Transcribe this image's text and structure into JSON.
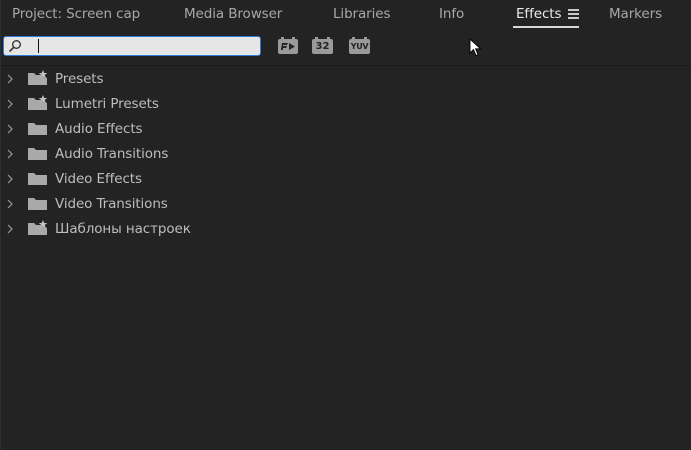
{
  "tabs": [
    {
      "label": "Project: Screen cap",
      "active": false
    },
    {
      "label": "Media Browser",
      "active": false
    },
    {
      "label": "Libraries",
      "active": false
    },
    {
      "label": "Info",
      "active": false
    },
    {
      "label": "Effects",
      "active": true
    },
    {
      "label": "Markers",
      "active": false
    }
  ],
  "toolbar": {
    "search_value": "",
    "accelerated_label": "",
    "bit32_label": "32",
    "yuv_label": "YUV"
  },
  "tree": [
    {
      "label": "Presets",
      "icon": "preset-folder-icon"
    },
    {
      "label": "Lumetri Presets",
      "icon": "preset-folder-icon"
    },
    {
      "label": "Audio Effects",
      "icon": "folder-icon"
    },
    {
      "label": "Audio Transitions",
      "icon": "folder-icon"
    },
    {
      "label": "Video Effects",
      "icon": "folder-icon"
    },
    {
      "label": "Video Transitions",
      "icon": "folder-icon"
    },
    {
      "label": "Шаблоны настроек",
      "icon": "preset-folder-icon"
    }
  ],
  "colors": {
    "background": "#232323",
    "text": "#bdbdbd",
    "active_tab": "#e8e8e8",
    "search_focus": "#2f7bd9",
    "icon": "#9a9a9a"
  }
}
